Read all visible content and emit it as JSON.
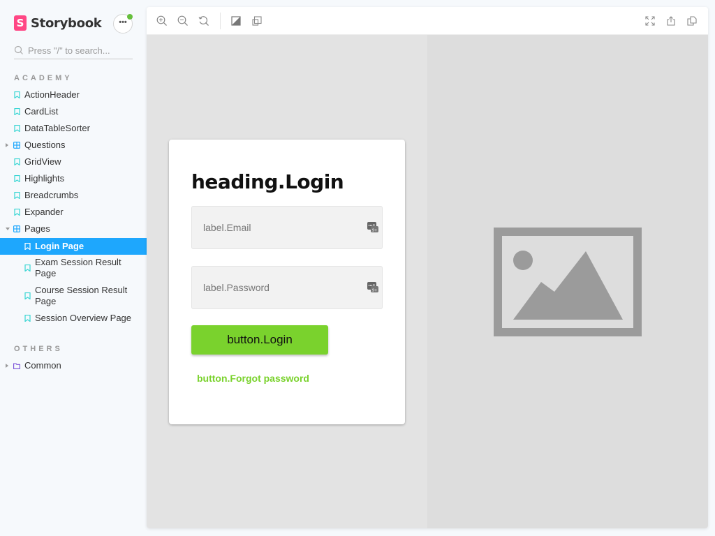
{
  "sidebar": {
    "brand": "Storybook",
    "brand_logo_letter": "S",
    "menu_dots": "•••",
    "search_placeholder": "Press \"/\" to search...",
    "sections": [
      {
        "title": "ACADEMY",
        "items": [
          {
            "label": "ActionHeader",
            "type": "story"
          },
          {
            "label": "CardList",
            "type": "story"
          },
          {
            "label": "DataTableSorter",
            "type": "story"
          },
          {
            "label": "Questions",
            "type": "component",
            "expandable": true,
            "expanded": false
          },
          {
            "label": "GridView",
            "type": "story"
          },
          {
            "label": "Highlights",
            "type": "story"
          },
          {
            "label": "Breadcrumbs",
            "type": "story"
          },
          {
            "label": "Expander",
            "type": "story"
          },
          {
            "label": "Pages",
            "type": "component",
            "expandable": true,
            "expanded": true
          },
          {
            "label": "Login Page",
            "type": "story",
            "selected": true
          },
          {
            "label": "Exam Session Result Page",
            "type": "story"
          },
          {
            "label": "Course Session Result Page",
            "type": "story"
          },
          {
            "label": "Session Overview Page",
            "type": "story"
          }
        ]
      },
      {
        "title": "OTHERS",
        "items": [
          {
            "label": "Common",
            "type": "folder",
            "expandable": true,
            "expanded": false
          }
        ]
      }
    ]
  },
  "toolbar": {
    "left_tools": [
      "zoom-in",
      "zoom-out",
      "zoom-reset",
      "background",
      "outline"
    ],
    "right_tools": [
      "fullscreen",
      "open-new-tab",
      "copy-link"
    ]
  },
  "preview": {
    "heading": "heading.Login",
    "email_label": "label.Email",
    "password_label": "label.Password",
    "login_button": "button.Login",
    "forgot_button": "button.Forgot password"
  },
  "colors": {
    "accent": "#1ea7fd",
    "brand": "#ff4785",
    "primary_button": "#7ad22d",
    "notification": "#66bf3c",
    "story_icon": "#37d5d3",
    "component_icon": "#1ea7fd",
    "folder_icon": "#774dd7"
  }
}
